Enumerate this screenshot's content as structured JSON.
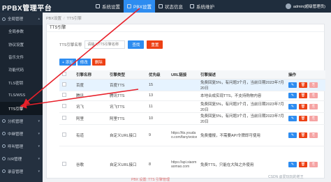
{
  "app": {
    "title": "PPBX管理平台"
  },
  "topnav": [
    {
      "label": "系统设置"
    },
    {
      "label": "PBX设置"
    },
    {
      "label": "状态信息"
    },
    {
      "label": "系统维护"
    }
  ],
  "user": {
    "name": "admin(超级管理员)"
  },
  "sidebar": {
    "items": [
      {
        "label": "全局管理"
      },
      {
        "label": "全局参数"
      },
      {
        "label": "协议设置"
      },
      {
        "label": "音乐文件"
      },
      {
        "label": "功能代码"
      },
      {
        "label": "TLS密钥"
      },
      {
        "label": "TLS/WSS"
      },
      {
        "label": "TTS引擎"
      },
      {
        "label": "分机管理"
      },
      {
        "label": "中继管理"
      },
      {
        "label": "呼叫管理"
      },
      {
        "label": "IVR管理"
      },
      {
        "label": "录音管理"
      }
    ]
  },
  "breadcrumb": {
    "parent": "PBX设置",
    "current": "TTS引擎"
  },
  "panel": {
    "title": "TTS引擎"
  },
  "filter": {
    "label": "TTS引擎名称",
    "placeholder": "请输入TTS引擎名称",
    "search_label": "查找",
    "reset_label": "重置"
  },
  "toolbar": {
    "add_label": "+ 添加",
    "edit_label": "修改",
    "delete_label": "删除"
  },
  "table": {
    "columns": [
      "",
      "引擎名称",
      "引擎类型",
      "优先级",
      "URL链接",
      "引擎描述",
      "操作"
    ],
    "rows": [
      {
        "name": "百度",
        "type": "百度TTS",
        "priority": "15",
        "url": "",
        "desc": "免费回复5%，有问题3个月，当前日期2023年7月20日"
      },
      {
        "name": "腾讯",
        "type": "腾讯TTS",
        "priority": "13",
        "url": "",
        "desc": "本地合成实现TTS，不支持购物内容"
      },
      {
        "name": "讯飞",
        "type": "讯飞TTS",
        "priority": "11",
        "url": "",
        "desc": "免费回复5%，有问题3个月，当前日期2023年7月20日"
      },
      {
        "name": "阿里",
        "type": "阿里TTS",
        "priority": "10",
        "url": "",
        "desc": "免费回复5%，有问题3个月，当前日期2023年7月20日"
      },
      {
        "name": "有道",
        "type": "自定义URL接口",
        "priority": "9",
        "url": "https://tts.youdao.com/fanyivoice",
        "desc": "免费播报，不需要API令牌即可使用"
      },
      {
        "name": "谷歌",
        "type": "自定义URL接口",
        "priority": "8",
        "url": "https://api.xiaomaomao.com",
        "desc": "免费TTS，只能在大陆之外使用"
      }
    ]
  },
  "watermark": "CSDN @爱玩玩的老王",
  "footer": "PBX 设置: TTS 引擎管理",
  "colors": {
    "primary": "#2d8cf0",
    "danger": "#ed4014",
    "sidebar": "#24303f",
    "topbar": "#1f2d3d",
    "arrow": "#e8202a"
  }
}
